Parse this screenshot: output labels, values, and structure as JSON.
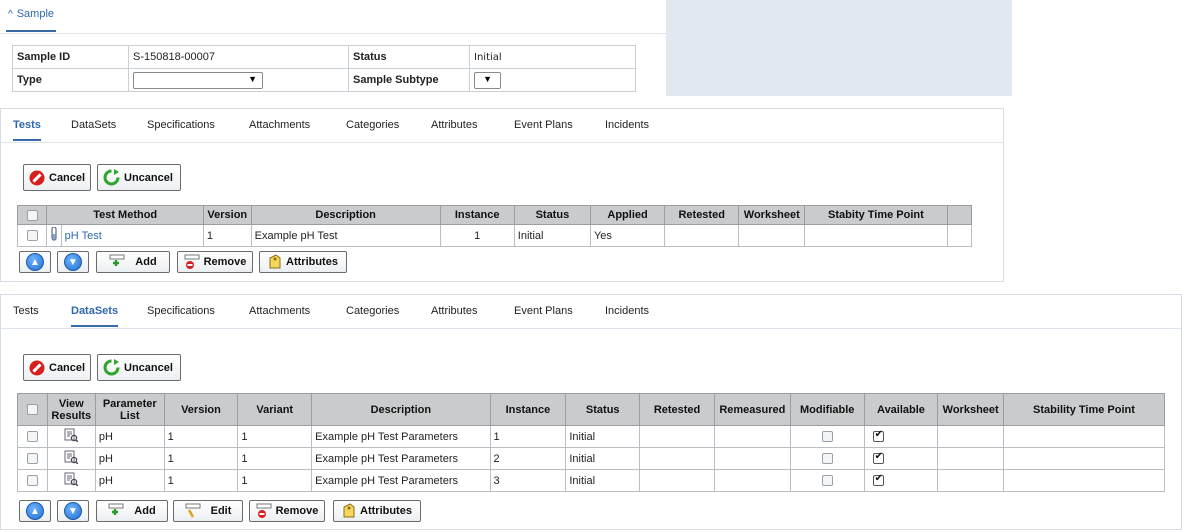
{
  "sample": {
    "title": "Sample",
    "fields": {
      "sample_id_label": "Sample ID",
      "sample_id_value": "S-150818-00007",
      "status_label": "Status",
      "status_value": "Initial",
      "type_label": "Type",
      "type_value": "",
      "subtype_label": "Sample Subtype",
      "subtype_value": ""
    }
  },
  "tabs": [
    "Tests",
    "DataSets",
    "Specifications",
    "Attachments",
    "Categories",
    "Attributes",
    "Event Plans",
    "Incidents"
  ],
  "toolbar": {
    "cancel": "Cancel",
    "uncancel": "Uncancel"
  },
  "tests_panel": {
    "active_tab": "Tests",
    "columns": [
      "Test Method",
      "Version",
      "Description",
      "Instance",
      "Status",
      "Applied",
      "Retested",
      "Worksheet",
      "Stabity Time Point"
    ],
    "rows": [
      {
        "test_method": "pH Test",
        "version": "1",
        "description": "Example pH Test",
        "instance": "1",
        "status": "Initial",
        "applied": "Yes",
        "retested": "",
        "worksheet": "",
        "stability": ""
      }
    ],
    "bottom": {
      "add": "Add",
      "remove": "Remove",
      "attributes": "Attributes"
    }
  },
  "datasets_panel": {
    "active_tab": "DataSets",
    "columns": [
      "View Results",
      "Parameter List",
      "Version",
      "Variant",
      "Description",
      "Instance",
      "Status",
      "Retested",
      "Remeasured",
      "Modifiable",
      "Available",
      "Worksheet",
      "Stability Time Point"
    ],
    "rows": [
      {
        "param_list": "pH",
        "version": "1",
        "variant": "1",
        "description": "Example pH Test Parameters",
        "instance": "1",
        "status": "Initial",
        "modifiable": false,
        "available": true
      },
      {
        "param_list": "pH",
        "version": "1",
        "variant": "1",
        "description": "Example pH Test Parameters",
        "instance": "2",
        "status": "Initial",
        "modifiable": false,
        "available": true
      },
      {
        "param_list": "pH",
        "version": "1",
        "variant": "1",
        "description": "Example pH Test Parameters",
        "instance": "3",
        "status": "Initial",
        "modifiable": false,
        "available": true
      }
    ],
    "bottom": {
      "add": "Add",
      "edit": "Edit",
      "remove": "Remove",
      "attributes": "Attributes"
    }
  },
  "colors": {
    "accent": "#2f67b0",
    "header_bg": "#c9cbcd",
    "side_bg": "#e2e8f0"
  },
  "icons": {
    "cancel": "cancel-icon",
    "uncancel": "refresh-icon",
    "move_up": "arrow-up-icon",
    "move_down": "arrow-down-icon",
    "add": "add-icon",
    "remove": "remove-icon",
    "edit": "edit-icon",
    "attributes": "attributes-icon",
    "test": "test-tube-icon",
    "view_results": "view-results-icon"
  }
}
